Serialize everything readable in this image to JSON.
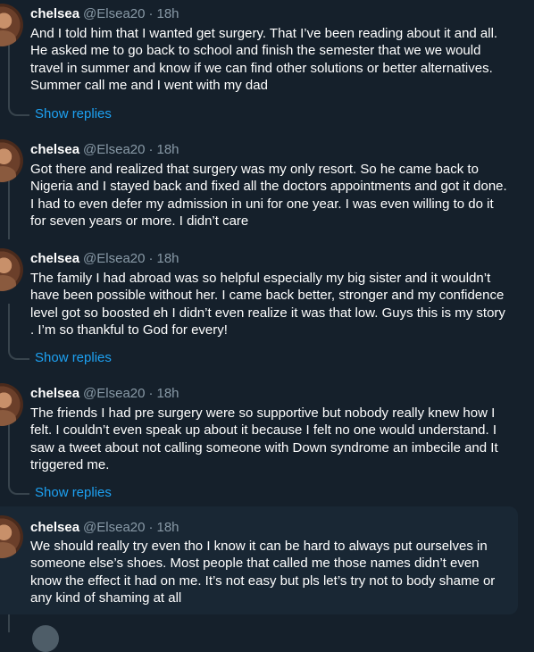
{
  "tweets": [
    {
      "name": "chelsea",
      "handle": "@Elsea20",
      "time": "18h",
      "text": "And I told him that I wanted get surgery. That I’ve been reading about it and all. He asked me to go back to school and finish the semester that we we would travel in summer and know if we can find other solutions or better alternatives. Summer call me and I went with my dad",
      "show_replies": "Show replies"
    },
    {
      "name": "chelsea",
      "handle": "@Elsea20",
      "time": "18h",
      "text": "Got there and realized that surgery was my only resort. So he came back to Nigeria and I stayed back and fixed all the doctors appointments and got it done. I had to even defer my admission in uni for one year. I was even willing to do it for seven years or more. I didn’t care"
    },
    {
      "name": "chelsea",
      "handle": "@Elsea20",
      "time": "18h",
      "text": "The family I had abroad was so helpful especially my big sister and it wouldn’t have been possible without her. I came back better, stronger and my confidence level got so boosted eh I didn’t even realize it was that low. Guys this is my story . I’m so thankful to God for every!",
      "show_replies": "Show replies"
    },
    {
      "name": "chelsea",
      "handle": "@Elsea20",
      "time": "18h",
      "text": "The friends I had pre surgery were so supportive but nobody really knew how I felt. I couldn’t even speak up about it because I felt no one would understand. I saw a tweet about not calling someone with Down syndrome an imbecile and It triggered me.",
      "show_replies": "Show replies"
    },
    {
      "name": "chelsea",
      "handle": "@Elsea20",
      "time": "18h",
      "text": "We should really try even tho I know it can be hard to always put ourselves in someone else’s shoes. Most people that called me those names didn’t even know the effect it had on me. It’s not easy but pls let’s try not to body shame or any kind of shaming at all"
    }
  ],
  "colors": {
    "background": "#15202b",
    "highlight": "#192734",
    "accent": "#1da1f2",
    "secondary_text": "#8899a6",
    "thread_line": "#38444d"
  }
}
